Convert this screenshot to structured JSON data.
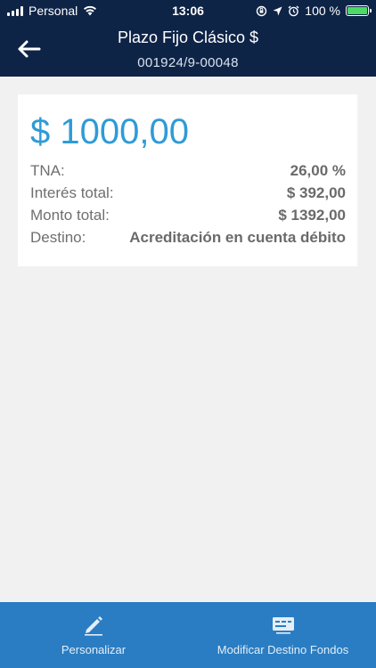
{
  "status_bar": {
    "carrier": "Personal",
    "time": "13:06",
    "battery": "100 %",
    "battery_level": 1.0
  },
  "header": {
    "title": "Plazo Fijo Clásico $",
    "subtitle": "001924/9-00048",
    "back_icon": "arrow-left-icon"
  },
  "card": {
    "amount": "$ 1000,00",
    "rows": [
      {
        "label": "TNA:",
        "value": "26,00 %"
      },
      {
        "label": "Interés total:",
        "value": "$ 392,00"
      },
      {
        "label": "Monto total:",
        "value": "$ 1392,00"
      },
      {
        "label": "Destino:",
        "value": "Acreditación en cuenta débito"
      }
    ]
  },
  "bottom_bar": {
    "items": [
      {
        "label": "Personalizar",
        "icon": "pencil-icon"
      },
      {
        "label": "Modificar Destino Fondos",
        "icon": "card-icon"
      }
    ]
  },
  "colors": {
    "header_bg": "#0e2447",
    "accent": "#2f9bd6",
    "bottom_bar_bg": "#2a7dc2",
    "page_bg": "#f1f1f1",
    "battery_green": "#4cd964"
  }
}
